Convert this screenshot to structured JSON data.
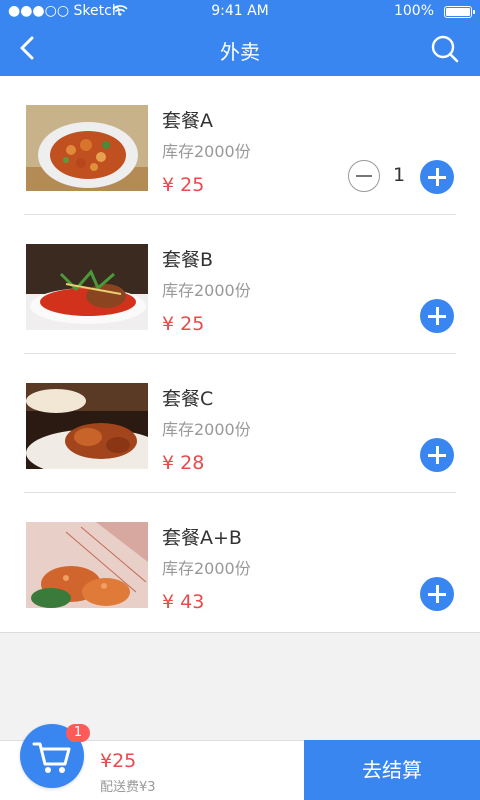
{
  "status_bar": {
    "carrier": "●●●○○ Sketch",
    "time": "9:41 AM",
    "battery": "100%"
  },
  "header": {
    "title": "外卖"
  },
  "items": [
    {
      "name": "套餐A",
      "stock": "库存2000份",
      "price": "¥ 25",
      "quantity": "1"
    },
    {
      "name": "套餐B",
      "stock": "库存2000份",
      "price": "¥ 25"
    },
    {
      "name": "套餐C",
      "stock": "库存2000份",
      "price": "¥ 28"
    },
    {
      "name": "套餐A+B",
      "stock": "库存2000份",
      "price": "¥ 43"
    }
  ],
  "cart": {
    "badge": "1",
    "total": "¥25",
    "delivery_fee": "配送费¥3",
    "checkout_label": "去结算"
  },
  "colors": {
    "primary": "#3a86f0",
    "price": "#e84a4a",
    "badge": "#ff5a5a"
  },
  "icons": [
    "back-icon",
    "search-icon",
    "wifi-icon",
    "battery-icon",
    "minus-icon",
    "plus-icon",
    "cart-icon"
  ]
}
